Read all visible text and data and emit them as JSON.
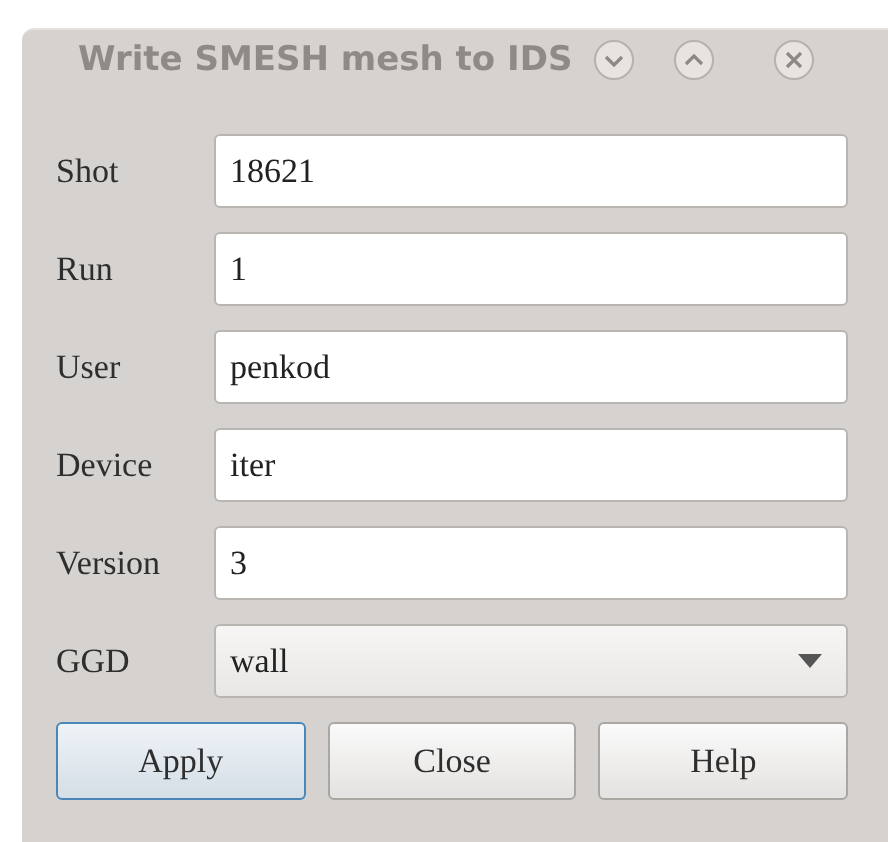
{
  "window": {
    "title": "Write SMESH mesh to IDS"
  },
  "fields": [
    {
      "kind": "text",
      "label": "Shot",
      "value": "18621"
    },
    {
      "kind": "text",
      "label": "Run",
      "value": "1"
    },
    {
      "kind": "text",
      "label": "User",
      "value": "penkod"
    },
    {
      "kind": "text",
      "label": "Device",
      "value": "iter"
    },
    {
      "kind": "text",
      "label": "Version",
      "value": "3"
    },
    {
      "kind": "dropdown",
      "label": "GGD",
      "value": "wall"
    }
  ],
  "buttons": [
    {
      "label": "Apply",
      "default": true
    },
    {
      "label": "Close",
      "default": false
    },
    {
      "label": "Help",
      "default": false
    }
  ]
}
